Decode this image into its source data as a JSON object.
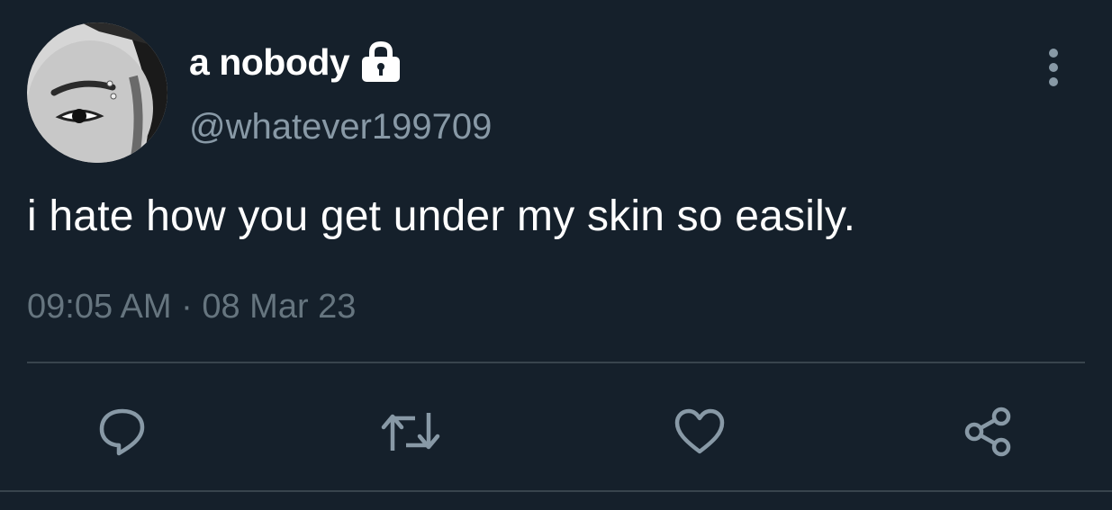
{
  "tweet": {
    "display_name": "a nobody",
    "handle": "@whatever199709",
    "text": "i hate how you get under my skin so easily.",
    "time": "09:05 AM",
    "separator": "·",
    "date": "08 Mar 23",
    "protected_icon": "lock-icon",
    "avatar": "profile-photo"
  },
  "actions": [
    {
      "name": "reply",
      "icon": "reply-icon"
    },
    {
      "name": "retweet",
      "icon": "retweet-icon"
    },
    {
      "name": "like",
      "icon": "heart-icon"
    },
    {
      "name": "share",
      "icon": "share-icon"
    }
  ],
  "colors": {
    "background": "#15202b",
    "primary_text": "#ffffff",
    "secondary_text": "#8899a6",
    "timestamp": "#66757f",
    "divider": "#38444d",
    "icon": "#8899a6"
  }
}
